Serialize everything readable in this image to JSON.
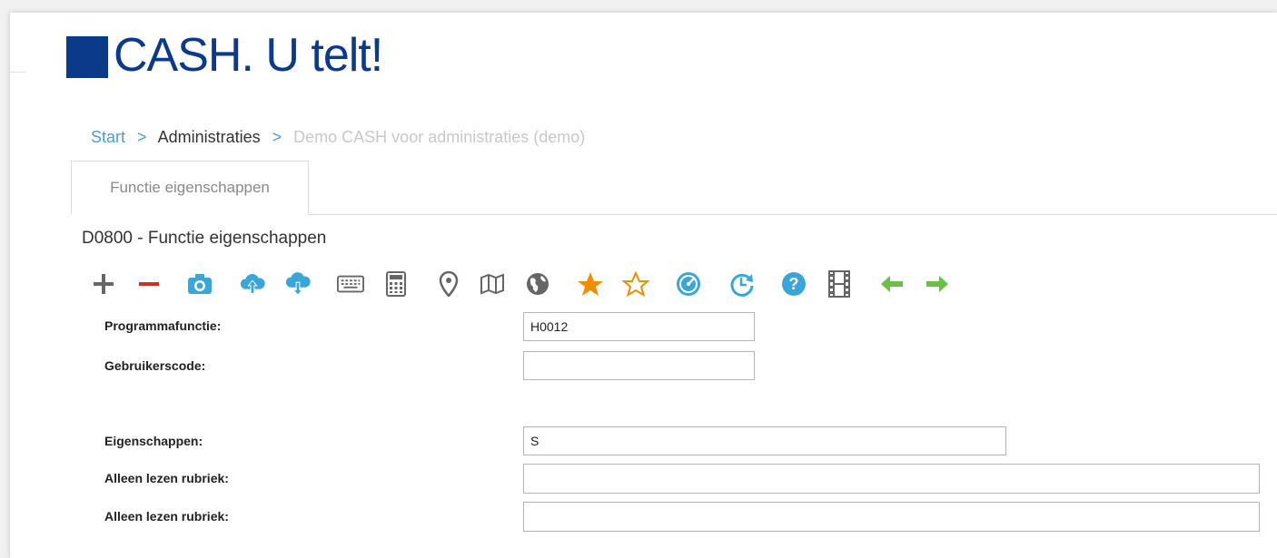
{
  "logo": {
    "text": "CASH. U telt!"
  },
  "breadcrumb": {
    "items": [
      {
        "label": "Start"
      },
      {
        "label": "Administraties"
      },
      {
        "label": "Demo CASH voor administraties (demo)"
      }
    ],
    "separator": ">"
  },
  "tabs": [
    {
      "label": "Functie eigenschappen",
      "active": true
    }
  ],
  "page_title": "D0800 - Functie eigenschappen",
  "toolbar": {
    "icons": [
      "plus-icon",
      "minus-icon",
      "camera-icon",
      "cloud-upload-icon",
      "cloud-download-icon",
      "keyboard-icon",
      "calculator-icon",
      "map-pin-icon",
      "map-icon",
      "globe-icon",
      "star-filled-icon",
      "star-outline-icon",
      "speedometer-icon",
      "refresh-clock-icon",
      "help-icon",
      "film-icon",
      "arrow-left-icon",
      "arrow-right-icon"
    ]
  },
  "form": {
    "programmafunctie": {
      "label": "Programmafunctie:",
      "value": "H0012"
    },
    "gebruikerscode": {
      "label": "Gebruikerscode:",
      "value": ""
    },
    "eigenschappen": {
      "label": "Eigenschappen:",
      "value": "S"
    },
    "alleen_lezen_1": {
      "label": "Alleen lezen rubriek:",
      "value": ""
    },
    "alleen_lezen_2": {
      "label": "Alleen lezen rubriek:",
      "value": ""
    }
  },
  "colors": {
    "brand": "#0b3a8a",
    "link": "#4a9fd5",
    "icon_blue": "#3aa6d8",
    "icon_orange": "#f28c00",
    "icon_green": "#6cc04a",
    "icon_red": "#e2271c",
    "icon_gray": "#666666"
  }
}
